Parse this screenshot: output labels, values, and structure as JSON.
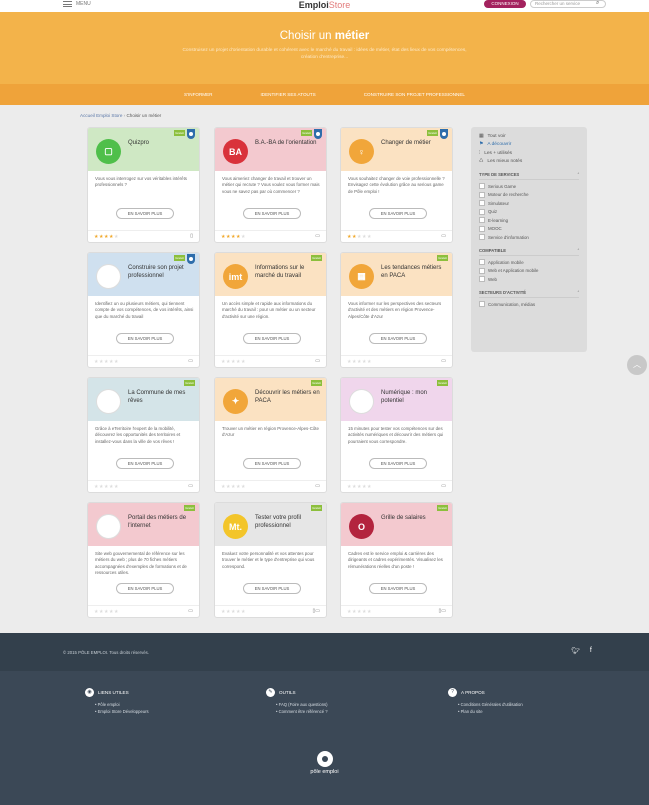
{
  "topbar": {
    "menu_label": "MENU",
    "brand_main": "Emploi",
    "brand_lite": "Store",
    "login_label": "CONNEXION",
    "search_placeholder": "Rechercher un service"
  },
  "banner": {
    "title_prefix": "Choisir un ",
    "title_bold": "métier",
    "subtitle": "Construisez un projet d'orientation durable et cohérent avec le marché du travail : idées de métier, état des lieux de vos compétences, création d'entreprise..."
  },
  "subnav": [
    "S'INFORMER",
    "IDENTIFIER SES ATOUTS",
    "CONSTRUIRE SON PROJET PROFESSIONNEL"
  ],
  "breadcrumb": {
    "home": "Accueil Emploi Store",
    "sep": "›",
    "current": "Choisir un métier"
  },
  "common": {
    "more_label": "EN SAVOIR PLUS",
    "badge_label": "Gratuit"
  },
  "cards": [
    {
      "title": "Quizpro",
      "desc": "Vous vous interrogez sur vos véritables intérêts professionnels ?",
      "stars": "★★★★★",
      "rating": 4,
      "device": "▯",
      "color": "#cfe8c4",
      "logo_color": "#4fbf4a",
      "logo_text": "▢",
      "badge2": true
    },
    {
      "title": "B.A.-BA de l'orientation",
      "desc": "Vous aimeriez changer de travail et trouver un métier qui recrute ? Vous voulez vous former mais vous ne savez pas par où commencer ?",
      "stars": "★★★★★",
      "rating": 4,
      "device": "▭",
      "color": "#f3c9cf",
      "logo_color": "#d9323b",
      "logo_text": "BA",
      "badge2": true
    },
    {
      "title": "Changer de métier",
      "desc": "Vous souhaitez changer de voie professionnelle ? Envisagez cette évolution grâce au serious game de Pôle emploi !",
      "stars": "★★★★★",
      "rating": 2,
      "device": "▭",
      "color": "#fbe2c2",
      "logo_color": "#f1a63a",
      "logo_text": "♀",
      "badge2": true
    },
    {
      "title": "Construire son projet professionnel",
      "desc": "Identifiez un ou plusieurs métiers, qui tiennent compte de vos compétences, de vos intérêts, ainsi que du marché du travail",
      "stars": "★★★★★",
      "rating": 0,
      "device": "▭",
      "color": "#cfe0ef",
      "logo_color": "#ffffff",
      "logo_text": "",
      "badge2": true
    },
    {
      "title": "Informations sur le marché du travail",
      "desc": "Un accès simple et rapide aux informations du marché du travail : pour un métier ou un secteur d'activité sur une région.",
      "stars": "★★★★★",
      "rating": 0,
      "device": "▭",
      "color": "#fbe2c2",
      "logo_color": "#f1a63a",
      "logo_text": "imt",
      "badge2": false
    },
    {
      "title": "Les tendances métiers en PACA",
      "desc": "Vous informer sur les perspectives des secteurs d'activité et des métiers en région Provence-Alpes/Côte d'Azur",
      "stars": "★★★★★",
      "rating": 0,
      "device": "▭",
      "color": "#fbe2c2",
      "logo_color": "#f1a63a",
      "logo_text": "▦",
      "badge2": false
    },
    {
      "title": "La Commune de mes rêves",
      "desc": "Grâce à eTerritoire l'expert de la mobilité, découvrez les opportunités des territoires et installez-vous dans la ville de vos rêves !",
      "stars": "★★★★★",
      "rating": 0,
      "device": "▭",
      "color": "#d4e4e8",
      "logo_color": "#ffffff",
      "logo_text": "",
      "badge2": false
    },
    {
      "title": "Découvrir les métiers en PACA",
      "desc": "Trouver un métier en région Provence-Alpes-Côte d'Azur",
      "stars": "★★★★★",
      "rating": 0,
      "device": "▭",
      "color": "#fbe2c2",
      "logo_color": "#f1a63a",
      "logo_text": "✦",
      "badge2": false
    },
    {
      "title": "Numérique : mon potentiel",
      "desc": "15 minutes pour tester vos compétences sur des activités numériques et découvrir des métiers qui pourraient vous correspondre.",
      "stars": "★★★★★",
      "rating": 0,
      "device": "▭",
      "color": "#f0d6ec",
      "logo_color": "#ffffff",
      "logo_text": "",
      "badge2": false
    },
    {
      "title": "Portail des métiers de l'internet",
      "desc": "Site web gouvernemental de référence sur les métiers du web ; plus de 70 fiches métiers accompagnées d'exemples de formations et de ressources utiles.",
      "stars": "★★★★★",
      "rating": 0,
      "device": "▭",
      "color": "#f3c9cf",
      "logo_color": "#ffffff",
      "logo_text": "",
      "badge2": false
    },
    {
      "title": "Tester votre profil professionnel",
      "desc": "Evaluez votre personnalité et vos attentes pour trouver le métier et le type d'entreprise qui vous correspond.",
      "stars": "★★★★★",
      "rating": 0,
      "device": "▯▭",
      "color": "#e6e6e6",
      "logo_color": "#f3c52a",
      "logo_text": "Mt.",
      "badge2": false
    },
    {
      "title": "Grille de salaires",
      "desc": "Cadres est le service emploi & carrières des dirigeants et cadres expérimentés. Visualisez les rémunérations réelles d'un poste !",
      "stars": "★★★★★",
      "rating": 0,
      "device": "▯▭",
      "color": "#f3c9cf",
      "logo_color": "#b3243e",
      "logo_text": "O",
      "badge2": false
    }
  ],
  "sidebar": {
    "sort": [
      {
        "icon": "▦",
        "label": "Tout voir",
        "active": false
      },
      {
        "icon": "⚑",
        "label": "A découvrir",
        "active": true
      },
      {
        "icon": "⫶",
        "label": "Les + utilisés",
        "active": false
      },
      {
        "icon": "♺",
        "label": "Les mieux notés",
        "active": false
      }
    ],
    "services_title": "TYPE DE SERVICES",
    "services": [
      "Serious Game",
      "Moteur de recherche",
      "Simulateur",
      "Quiz",
      "E-learning",
      "MOOC",
      "Service d'information"
    ],
    "compat_title": "COMPATIBLE",
    "compat": [
      "Application mobile",
      "Web et Application mobile",
      "Web"
    ],
    "sector_title": "SECTEURS D'ACTIVITÉ",
    "sector": [
      "Communication, médias"
    ]
  },
  "footer": {
    "copyright": "© 2015 PÔLE EMPLOI. Tous droits réservés.",
    "cols": [
      {
        "title": "LIENS UTILES",
        "icon": "◉",
        "links": [
          "Pôle emploi",
          "Emploi Store Développeurs"
        ]
      },
      {
        "title": "OUTILS",
        "icon": "✎",
        "links": [
          "FAQ (Foire aux questions)",
          "Comment être référencé ?"
        ]
      },
      {
        "title": "A PROPOS",
        "icon": "?",
        "links": [
          "Conditions Générales d'utilisation",
          "Plan du site"
        ]
      }
    ],
    "logo_text": "pôle emploi"
  }
}
